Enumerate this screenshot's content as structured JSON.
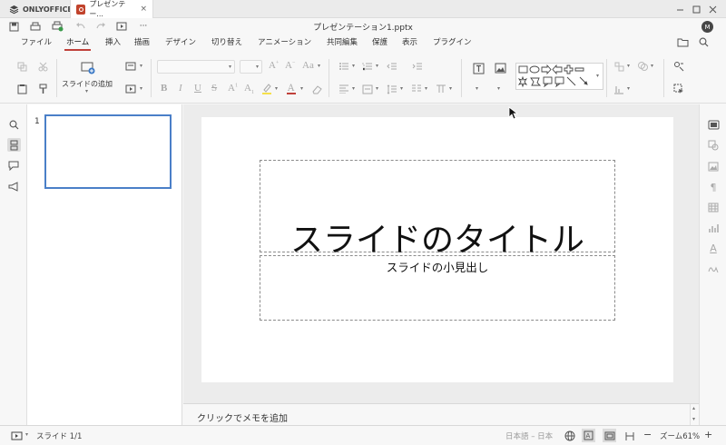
{
  "titlebar": {
    "app_tab": "ONLYOFFICE",
    "doc_tab": "プレゼンテー..."
  },
  "quickaccess": {
    "document_title": "プレゼンテーション1.pptx",
    "user_initial": "M",
    "more": "···"
  },
  "menu": {
    "tabs": [
      "ファイル",
      "ホーム",
      "挿入",
      "描画",
      "デザイン",
      "切り替え",
      "アニメーション",
      "共同編集",
      "保護",
      "表示",
      "プラグイン"
    ],
    "active_tab": "ホーム"
  },
  "toolbar": {
    "add_slide_label": "スライドの追加"
  },
  "thumbnails": {
    "slide_number": "1"
  },
  "slide": {
    "title": "スライドのタイトル",
    "subtitle": "スライドの小見出し"
  },
  "notes": {
    "placeholder": "クリックでメモを追加"
  },
  "statusbar": {
    "slide_info": "スライド 1/1",
    "language": "日本語 – 日本",
    "zoom": "ズーム61%"
  },
  "colors": {
    "accent_red": "#c0413b",
    "selection_blue": "#4a7fc8",
    "font_highlight": "#f5e04a",
    "font_color_bar": "#c0413b"
  }
}
